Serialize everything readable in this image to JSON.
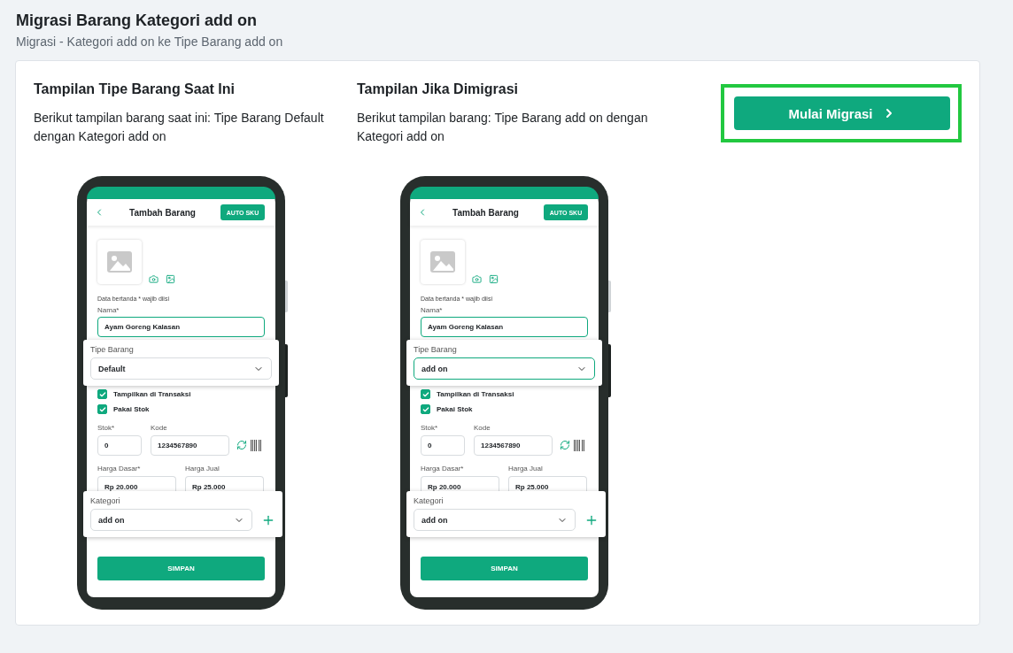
{
  "page": {
    "title": "Migrasi Barang Kategori add on",
    "subtitle": "Migrasi - Kategori add on ke Tipe Barang add on"
  },
  "panels": [
    {
      "heading": "Tampilan Tipe Barang Saat Ini",
      "description": "Berikut tampilan barang saat ini: Tipe Barang Default dengan Kategori add on",
      "phone": {
        "title": "Tambah Barang",
        "auto_sku": "AUTO SKU",
        "required_note": "Data bertanda * wajib diisi",
        "name_label": "Nama*",
        "name_value": "Ayam Goreng Kalasan",
        "type_label": "Tipe Barang",
        "type_value": "Default",
        "type_focused": false,
        "checkboxes": [
          {
            "label": "Tampilkan di Transaksi",
            "checked": true
          },
          {
            "label": "Pakai Stok",
            "checked": true
          }
        ],
        "stock_label": "Stok*",
        "stock_value": "0",
        "code_label": "Kode",
        "code_value": "1234567890",
        "base_price_label": "Harga Dasar*",
        "base_price_value": "Rp 20.000",
        "sell_price_label": "Harga Jual",
        "sell_price_value": "Rp 25.000",
        "category_label": "Kategori",
        "category_value": "add on",
        "save_label": "SIMPAN"
      }
    },
    {
      "heading": "Tampilan Jika Dimigrasi",
      "description": "Berikut tampilan barang: Tipe Barang add on dengan Kategori add on",
      "phone": {
        "title": "Tambah Barang",
        "auto_sku": "AUTO SKU",
        "required_note": "Data bertanda * wajib diisi",
        "name_label": "Nama*",
        "name_value": "Ayam Goreng Kalasan",
        "type_label": "Tipe Barang",
        "type_value": "add on",
        "type_focused": true,
        "checkboxes": [
          {
            "label": "Tampilkan di Transaksi",
            "checked": true
          },
          {
            "label": "Pakai Stok",
            "checked": true
          }
        ],
        "stock_label": "Stok*",
        "stock_value": "0",
        "code_label": "Kode",
        "code_value": "1234567890",
        "base_price_label": "Harga Dasar*",
        "base_price_value": "Rp 20.000",
        "sell_price_label": "Harga Jual",
        "sell_price_value": "Rp 25.000",
        "category_label": "Kategori",
        "category_value": "add on",
        "save_label": "SIMPAN"
      }
    }
  ],
  "start_button": {
    "label": "Mulai Migrasi",
    "highlighted": true
  }
}
